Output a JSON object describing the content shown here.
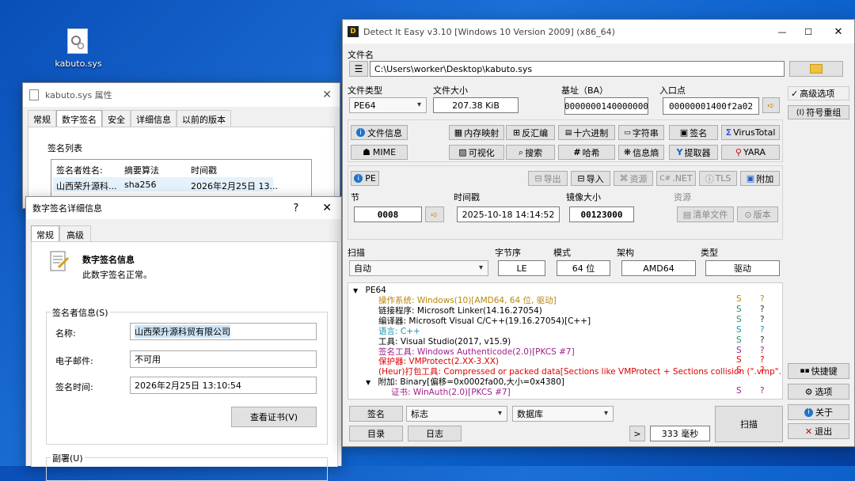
{
  "desktop": {
    "file_icon_label": "kabuto.sys"
  },
  "props": {
    "title": "kabuto.sys 属性",
    "tabs": [
      "常规",
      "数字签名",
      "安全",
      "详细信息",
      "以前的版本"
    ],
    "list_label": "签名列表",
    "columns": [
      "签名者姓名:",
      "摘要算法",
      "时间戳"
    ],
    "row": [
      "山西荣升源科...",
      "sha256",
      "2026年2月25日 13..."
    ]
  },
  "details": {
    "title": "数字签名详细信息",
    "help": "?",
    "close": "✕",
    "tabs": [
      "常规",
      "高级"
    ],
    "info_title": "数字签名信息",
    "info_text": "此数字签名正常。",
    "signer_group": "签名者信息(S)",
    "name_label": "名称:",
    "name_value": "山西荣升源科贸有限公司",
    "email_label": "电子邮件:",
    "email_value": "不可用",
    "time_label": "签名时间:",
    "time_value": "2026年2月25日 13:10:54",
    "view_cert": "查看证书(V)",
    "countersig": "副署(U)"
  },
  "die": {
    "title": "Detect It Easy v3.10 [Windows 10 Version 2009] (x86_64)",
    "file_label": "文件名",
    "file_path": "C:\\Users\\worker\\Desktop\\kabuto.sys",
    "type_label": "文件类型",
    "type_value": "PE64",
    "size_label": "文件大小",
    "size_value": "207.38 KiB",
    "base_label": "基址（BA）",
    "base_value": "0000000140000000",
    "entry_label": "入口点",
    "entry_value": "00000001400f2a02",
    "adv_options": "高级选项",
    "sym_reorg": "符号重组",
    "tools_row1": [
      "文件信息",
      "内存映射",
      "反汇编",
      "十六进制",
      "字符串",
      "签名",
      "VirusTotal"
    ],
    "tools_row2": [
      "MIME",
      "可视化",
      "搜索",
      "哈希",
      "信息熵",
      "提取器",
      "YARA"
    ],
    "pe_btn": "PE",
    "pe_tools": [
      "导出",
      "导入",
      "资源",
      ".NET",
      "TLS",
      "附加"
    ],
    "section_label": "节",
    "section_value": "0008",
    "timestamp_label": "时间戳",
    "timestamp_value": "2025-10-18 14:14:52",
    "image_size_label": "镜像大小",
    "image_size_value": "00123000",
    "resources_label": "资源",
    "manifest_btn": "清单文件",
    "version_btn": "版本",
    "scan_label": "扫描",
    "scan_value": "自动",
    "endian_label": "字节序",
    "endian_value": "LE",
    "mode_label": "模式",
    "mode_value": "64 位",
    "arch_label": "架构",
    "arch_value": "AMD64",
    "kind_label": "类型",
    "kind_value": "驱动",
    "tree_root": "PE64",
    "results": [
      {
        "label": "操作系统:",
        "value": " Windows(10)[AMD64, 64 位, 驱动]",
        "color": "#b8860b",
        "flag": "S",
        "q": "?"
      },
      {
        "label": "链接程序:",
        "value": " Microsoft Linker(14.16.27054)",
        "color": "#000000",
        "flag": "S",
        "q": "?"
      },
      {
        "label": "编译器:",
        "value": " Microsoft Visual C/C++(19.16.27054)[C++]",
        "color": "#000000",
        "flag": "S",
        "q": "?"
      },
      {
        "label": "语言:",
        "value": " C++",
        "color": "#1e90b0",
        "flag": "S",
        "q": "?"
      },
      {
        "label": "工具:",
        "value": " Visual Studio(2017, v15.9)",
        "color": "#000000",
        "flag": "S",
        "q": "?"
      },
      {
        "label": "签名工具:",
        "value": " Windows Authenticode(2.0)[PKCS #7]",
        "color": "#a0208a",
        "flag": "S",
        "q": "?"
      },
      {
        "label": "保护器:",
        "value": " VMProtect(2.XX-3.XX)",
        "color": "#e00000",
        "flag": "S",
        "q": "?"
      },
      {
        "label": "(Heur)打包工具:",
        "value": " Compressed or packed data[Sections like VMProtect + Sections collision (\".vmp\"...",
        "color": "#e00000",
        "flag": "S",
        "q": "?"
      }
    ],
    "overlay": {
      "label": "附加:",
      "value": " Binary[偏移=0x0002fa00,大小=0x4380]"
    },
    "overlay_child": {
      "label": "证书:",
      "value": " WinAuth(2.0)[PKCS #7]",
      "color": "#a0208a",
      "flag": "S",
      "q": "?"
    },
    "quick_build": "快捷键",
    "options": "选项",
    "about": "关于",
    "exit": "退出",
    "bottom_sig": "签名",
    "bottom_flags": "标志",
    "bottom_db": "数据库",
    "bottom_dir": "目录",
    "bottom_log": "日志",
    "next": ">",
    "elapsed": "333 毫秒",
    "scan_btn": "扫描"
  }
}
